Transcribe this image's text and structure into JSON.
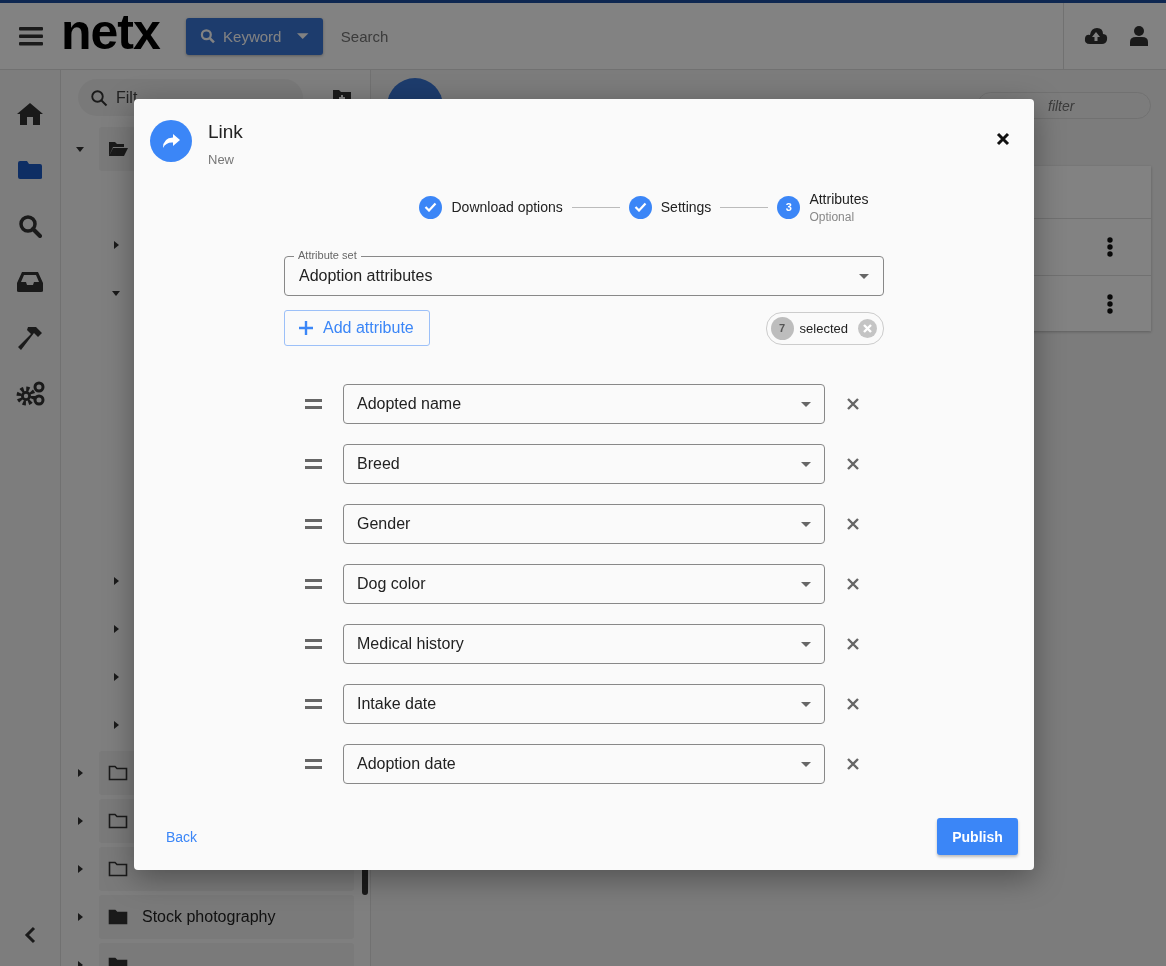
{
  "header": {
    "logo": "netx",
    "search_mode": "Keyword",
    "search_placeholder": "Search"
  },
  "nav_rail": [
    {
      "kind": "home",
      "selected": false
    },
    {
      "kind": "folder",
      "selected": true
    },
    {
      "kind": "search",
      "selected": false
    },
    {
      "kind": "inbox",
      "selected": false
    },
    {
      "kind": "hammer",
      "selected": false
    },
    {
      "kind": "gears",
      "selected": false
    }
  ],
  "folder_panel": {
    "filter_placeholder": "Filt",
    "tree": [
      {
        "expanded": true,
        "filled": false,
        "children": [
          {
            "expanded": false
          },
          {
            "expanded": true
          },
          {
            "expanded": false
          },
          {
            "expanded": false
          },
          {
            "expanded": false
          },
          {
            "expanded": false
          }
        ]
      },
      {
        "expanded": false,
        "filled": false
      },
      {
        "expanded": false,
        "filled": false
      },
      {
        "expanded": false,
        "filled": false
      },
      {
        "expanded": false,
        "filled": true,
        "label": "Stock photography"
      },
      {
        "expanded": false,
        "filled": true
      }
    ]
  },
  "main_panel": {
    "filter_placeholder": "filter"
  },
  "dialog": {
    "title": "Link",
    "subtitle": "New",
    "steps": [
      {
        "label": "Download options",
        "completed": true
      },
      {
        "label": "Settings",
        "completed": true
      },
      {
        "label": "Attributes",
        "number": "3",
        "caption": "Optional",
        "completed": false
      }
    ],
    "attribute_set": {
      "label": "Attribute set",
      "value": "Adoption attributes"
    },
    "add_button": "Add attribute",
    "selection": {
      "count": "7",
      "label": "selected"
    },
    "attributes": [
      "Adopted name",
      "Breed",
      "Gender",
      "Dog color",
      "Medical history",
      "Intake date",
      "Adoption date"
    ],
    "back": "Back",
    "publish": "Publish"
  }
}
